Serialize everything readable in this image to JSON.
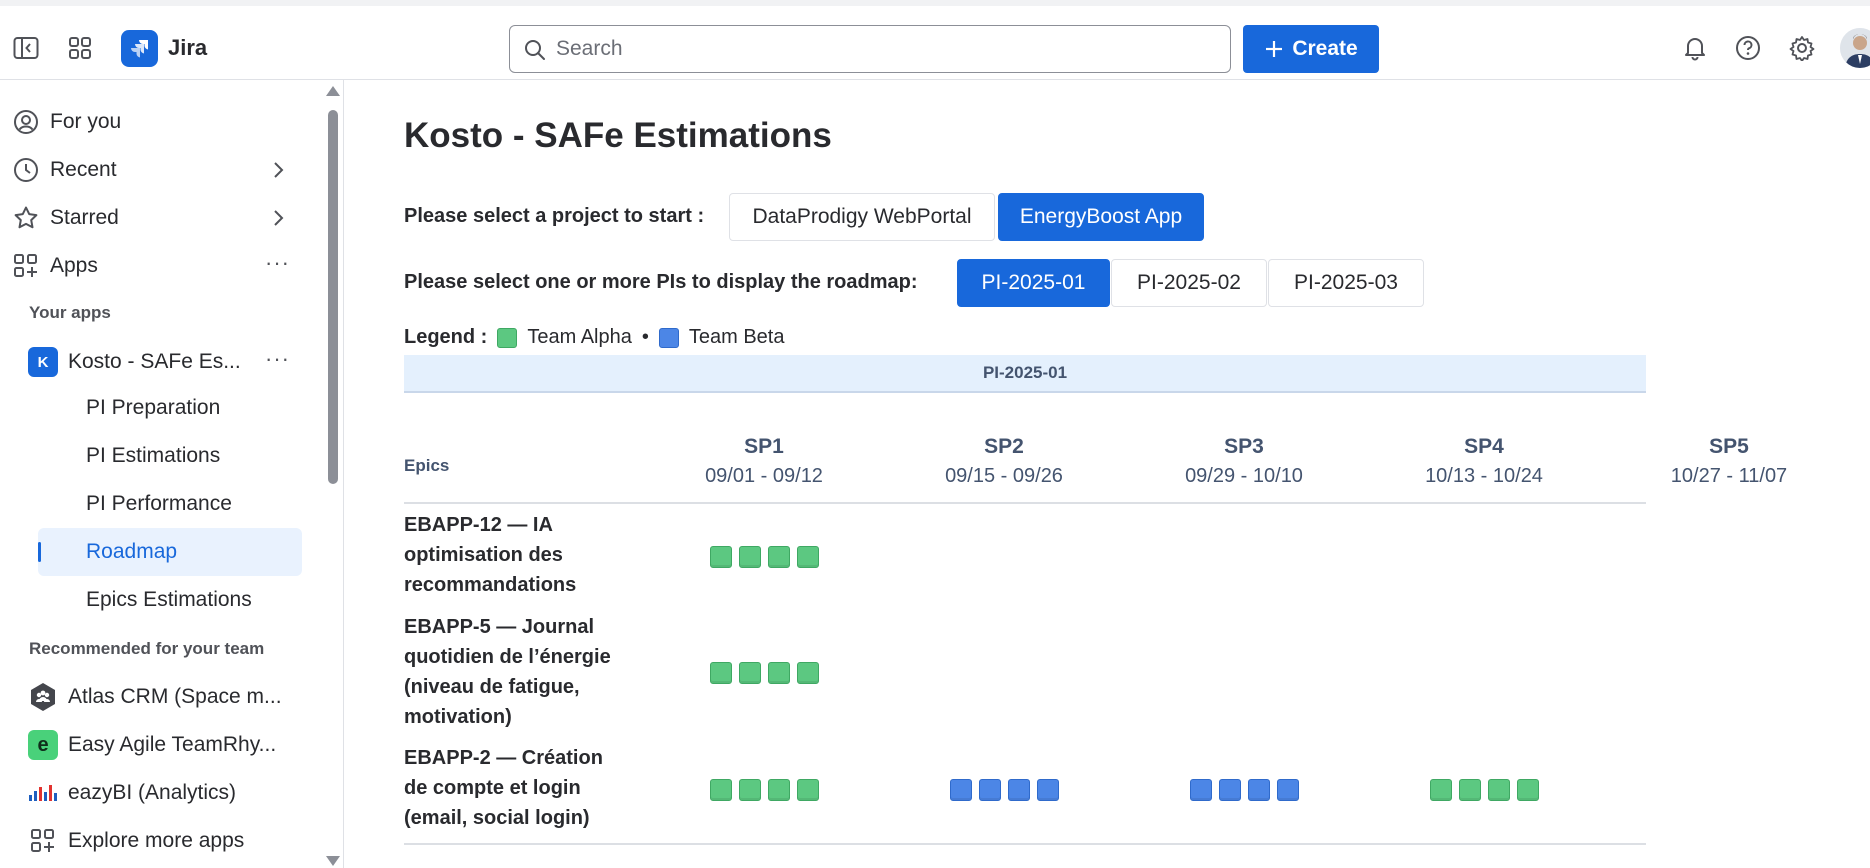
{
  "topbar": {
    "app_name": "Jira",
    "search_placeholder": "Search",
    "create_label": "Create"
  },
  "sidebar": {
    "nav": [
      {
        "label": "For you",
        "icon": "person-circle-icon"
      },
      {
        "label": "Recent",
        "icon": "clock-icon"
      },
      {
        "label": "Starred",
        "icon": "star-icon"
      },
      {
        "label": "Apps",
        "icon": "apps-icon"
      }
    ],
    "your_apps_label": "Your apps",
    "current_app": "Kosto - SAFe Es...",
    "sub_items": [
      "PI Preparation",
      "PI Estimations",
      "PI Performance",
      "Roadmap",
      "Epics Estimations"
    ],
    "active_sub_item": "Roadmap",
    "recommended_label": "Recommended for your team",
    "recommended_apps": [
      "Atlas CRM (Space m...",
      "Easy Agile TeamRhy...",
      "eazyBI (Analytics)"
    ],
    "explore_label": "Explore more apps"
  },
  "main": {
    "title": "Kosto - SAFe Estimations",
    "project_prompt": "Please select a project to start :",
    "projects": [
      {
        "label": "DataProdigy WebPortal",
        "selected": false
      },
      {
        "label": "EnergyBoost App",
        "selected": true
      }
    ],
    "pi_prompt": "Please select one or more PIs to display the roadmap:",
    "pis": [
      {
        "label": "PI-2025-01",
        "selected": true
      },
      {
        "label": "PI-2025-02",
        "selected": false
      },
      {
        "label": "PI-2025-03",
        "selected": false
      }
    ],
    "legend_label": "Legend :",
    "legend_sep": "•",
    "teams": [
      {
        "name": "Team Alpha",
        "color": "#5cc881"
      },
      {
        "name": "Team Beta",
        "color": "#4c86e6"
      }
    ],
    "pi_band": "PI-2025-01",
    "epics_header": "Epics",
    "sprints": [
      {
        "name": "SP1",
        "dates": "09/01 - 09/12"
      },
      {
        "name": "SP2",
        "dates": "09/15 - 09/26"
      },
      {
        "name": "SP3",
        "dates": "09/29 - 10/10"
      },
      {
        "name": "SP4",
        "dates": "10/13 - 10/24"
      },
      {
        "name": "SP5",
        "dates": "10/27 - 11/07"
      }
    ],
    "epics": [
      {
        "lines": [
          "EBAPP-12 — IA",
          "optimisation des",
          "recommandations"
        ],
        "sprint_blocks": [
          {
            "sprint": "SP1",
            "team": "alpha",
            "count": 4
          }
        ]
      },
      {
        "lines": [
          "EBAPP-5 — Journal",
          "quotidien de l’énergie",
          "(niveau de fatigue,",
          "motivation)"
        ],
        "sprint_blocks": [
          {
            "sprint": "SP1",
            "team": "alpha",
            "count": 4
          }
        ]
      },
      {
        "lines": [
          "EBAPP-2 — Création",
          "de compte et login",
          "(email, social login)"
        ],
        "sprint_blocks": [
          {
            "sprint": "SP1",
            "team": "alpha",
            "count": 4
          },
          {
            "sprint": "SP2",
            "team": "beta",
            "count": 4
          },
          {
            "sprint": "SP3",
            "team": "beta",
            "count": 4
          },
          {
            "sprint": "SP4",
            "team": "alpha",
            "count": 4
          }
        ]
      }
    ]
  }
}
